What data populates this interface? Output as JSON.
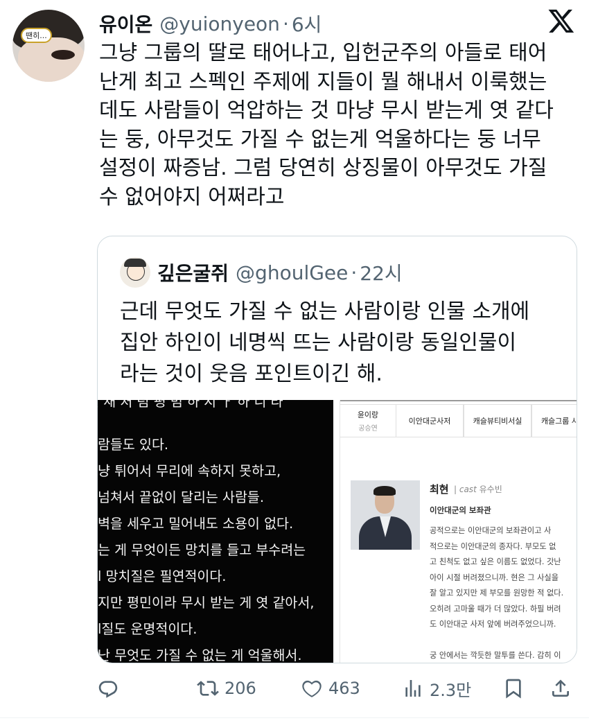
{
  "tweet": {
    "author_name": "유이온",
    "author_handle": "@yuionyeon",
    "separator": "·",
    "time": "6시",
    "avatar_tag": "땐히...",
    "text": "그냥 그룹의 딸로 태어나고, 입헌군주의 아들로 태어\n난게 최고 스펙인 주제에 지들이 뭘 해내서 이룩했는\n데도 사람들이 억압하는 것 마냥 무시 받는게 엿 같다\n는 둥, 아무것도 가질 수 없는게 억울하다는 둥 너무\n설정이 짜증남. 그럼 당연히 상징물이 아무것도 가질\n수 없어야지 어쩌라고"
  },
  "quote": {
    "author_name": "깊은굴쥐",
    "author_handle": "@ghoulGee",
    "separator": "·",
    "time": "22시",
    "text": "근데 무엇도 가질 수 없는 사람이랑 인물 소개에\n집안 하인이 네명씩 뜨는 사람이랑 동일인물이\n라는 것이 웃음 포인트이긴 해.",
    "left_image_lines": [
      "람들도 있다.",
      "냥 튀어서 무리에 속하지 못하고,",
      "넘쳐서 끝없이 달리는 사람들.",
      "벽을 세우고 밀어내도 소용이 없다.",
      "는 게 무엇이든 망치를 들고 부수려는 ",
      "l 망치질은 필연적이다.",
      "지만 평민이라 무시 받는 게 엿 같아서,",
      "l질도 운명적이다.",
      "난 무엇도 가질 수 없는 게 억울해서."
    ],
    "right_image": {
      "tabs": [
        {
          "label": "윤이랑",
          "sub": "공승연"
        },
        {
          "label": "이안대군사저",
          "sub": ""
        },
        {
          "label": "캐슬뷰티비서실",
          "sub": ""
        },
        {
          "label": "캐슬그룹 사",
          "sub": ""
        }
      ],
      "name": "최현",
      "cast_label": "cast",
      "cast_name": "유수빈",
      "role": "이안대군의 보좌관",
      "description": "공적으로는 이안대군의 보좌관이고 사\n적으로는 이안대군의 종자다. 부모도 없\n고 친척도 없고 싶은 이름도 없었다. 갓난\n아이 시절 버려졌으니까. 현은 그 사실을\n잘 알고 있지만 제 부모를 원망한 적 없다.\n오히려 고마울 때가 더 많았다. 하필 버려\n도 이안대군 사저 앞에 버려주었으니까.\n\n궁 안에서는 깍듯한 말투를 쓴다. 감히 이\n안대군과 눈을 맞추지도 않고, 살짝 숙인"
    }
  },
  "actions": {
    "reply_count": "",
    "retweet_count": "206",
    "like_count": "463",
    "views_count": "2.3만"
  },
  "icons": {
    "x_logo": "x-logo-icon",
    "reply": "reply-icon",
    "retweet": "retweet-icon",
    "like": "heart-icon",
    "views": "views-icon",
    "bookmark": "bookmark-icon",
    "share": "share-icon"
  },
  "colors": {
    "text": "#0f1419",
    "muted": "#536471",
    "border": "#cfd9de"
  }
}
